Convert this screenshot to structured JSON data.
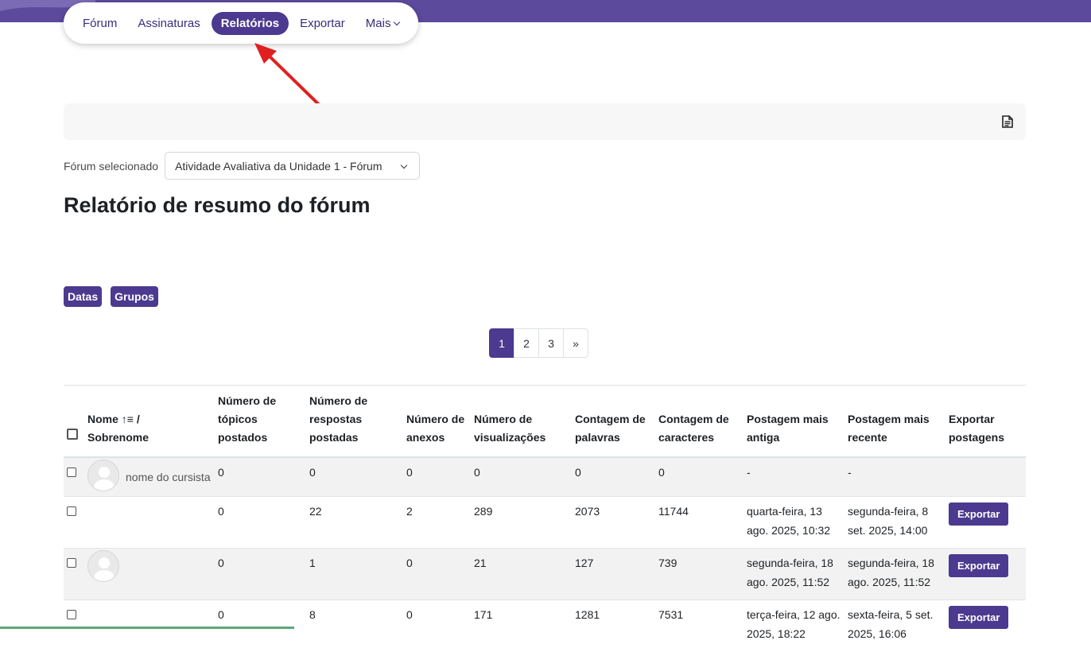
{
  "subnav": {
    "items": [
      {
        "label": "Fórum",
        "active": false
      },
      {
        "label": "Assinaturas",
        "active": false
      },
      {
        "label": "Relatórios",
        "active": true
      },
      {
        "label": "Exportar",
        "active": false
      },
      {
        "label": "Mais",
        "active": false
      }
    ]
  },
  "forum_select": {
    "label": "Fórum selecionado",
    "value": "Atividade Avaliativa da Unidade 1 - Fórum"
  },
  "page_title": "Relatório de resumo do fórum",
  "filters": [
    "Datas",
    "Grupos"
  ],
  "pagination": {
    "pages": [
      "1",
      "2",
      "3"
    ],
    "current": "1",
    "next": "»"
  },
  "table": {
    "headers": {
      "name_a": "Nome",
      "name_sep": "/",
      "name_b": "Sobrenome",
      "topics": "Número de tópicos postados",
      "replies": "Número de respostas postadas",
      "attachments": "Número de anexos",
      "views": "Número de visualizações",
      "words": "Contagem de palavras",
      "chars": "Contagem de caracteres",
      "earliest": "Postagem mais antiga",
      "latest": "Postagem mais recente",
      "export": "Exportar postagens"
    },
    "rows": [
      {
        "name": "nome do cursista",
        "topics": "0",
        "replies": "0",
        "attachments": "0",
        "views": "0",
        "words": "0",
        "chars": "0",
        "earliest": "-",
        "latest": "-",
        "export": ""
      },
      {
        "name": "",
        "topics": "0",
        "replies": "22",
        "attachments": "2",
        "views": "289",
        "words": "2073",
        "chars": "11744",
        "earliest": "quarta-feira, 13 ago. 2025, 10:32",
        "latest": "segunda-feira, 8 set. 2025, 14:00",
        "export": "Exportar"
      },
      {
        "name": "",
        "topics": "0",
        "replies": "1",
        "attachments": "0",
        "views": "21",
        "words": "127",
        "chars": "739",
        "earliest": "segunda-feira, 18 ago. 2025, 11:52",
        "latest": "segunda-feira, 18 ago. 2025, 11:52",
        "export": "Exportar"
      },
      {
        "name": "",
        "topics": "0",
        "replies": "8",
        "attachments": "0",
        "views": "171",
        "words": "1281",
        "chars": "7531",
        "earliest": "terça-feira, 12 ago. 2025, 18:22",
        "latest": "sexta-feira, 5 set. 2025, 16:06",
        "export": "Exportar"
      }
    ]
  },
  "icons": {
    "report_icon": "document-icon",
    "sort_icon": "sort-ascending-icon",
    "avatar_icon": "user-avatar-icon"
  },
  "colors": {
    "brand": "#4b3a8f",
    "top_band": "#5c4a9c",
    "annotation_arrow": "#e02020"
  }
}
